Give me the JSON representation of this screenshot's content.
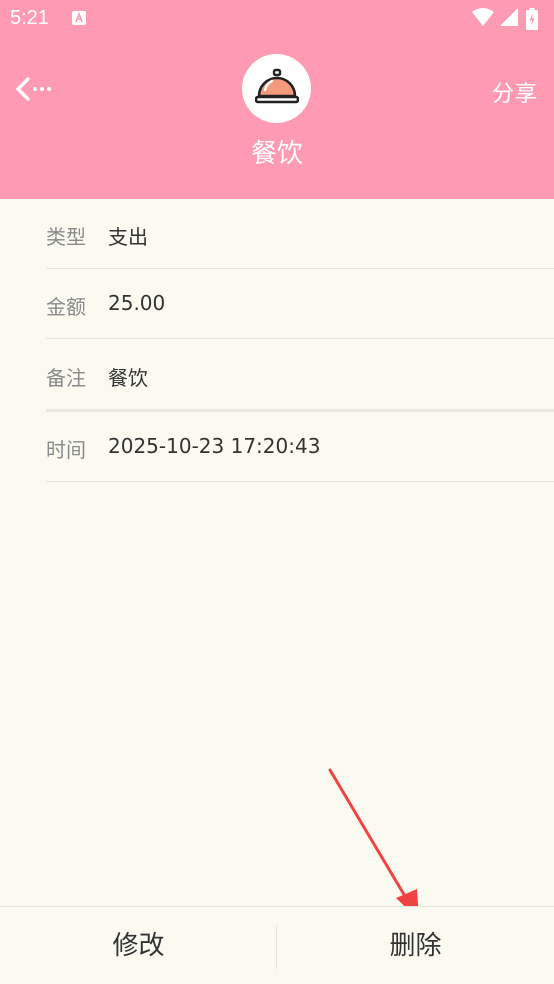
{
  "status_bar": {
    "time": "5:21",
    "notification_icon": "a-box-icon",
    "icons": [
      "wifi-icon",
      "signal-icon",
      "battery-icon"
    ]
  },
  "header": {
    "back_icon": "back-arrow-icon",
    "share_label": "分享",
    "category_icon": "dining-cloche-icon",
    "category_title": "餐饮",
    "background_color": "#FF9AB3"
  },
  "details": [
    {
      "label": "类型",
      "value": "支出"
    },
    {
      "label": "金额",
      "value": "25.00"
    },
    {
      "label": "备注",
      "value": "餐饮"
    },
    {
      "label": "时间",
      "value": "2025-10-23 17:20:43"
    }
  ],
  "footer": {
    "edit_label": "修改",
    "delete_label": "删除"
  },
  "accent_colors": {
    "arrow": "#F04444",
    "icon_fill": "#F49A7C"
  }
}
